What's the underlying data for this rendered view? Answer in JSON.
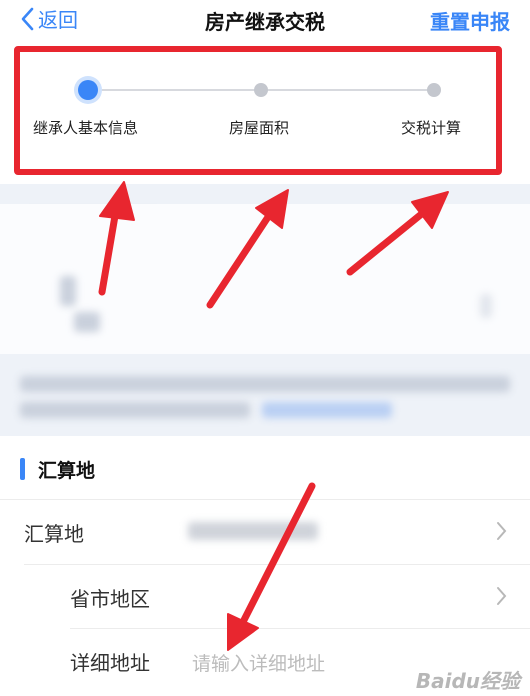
{
  "navbar": {
    "back_label": "返回",
    "title": "房产继承交税",
    "reset_label": "重置申报"
  },
  "steps": [
    {
      "label": "继承人基本信息",
      "state": "active"
    },
    {
      "label": "房屋面积",
      "state": "pending"
    },
    {
      "label": "交税计算",
      "state": "pending"
    }
  ],
  "section": {
    "title": "汇算地",
    "rows": [
      {
        "label": "汇算地"
      },
      {
        "label": "省市地区"
      },
      {
        "label": "详细地址",
        "placeholder": "请输入详细地址"
      }
    ]
  },
  "colors": {
    "accent": "#3a86f7",
    "highlight": "#e8262f"
  },
  "watermark": "Baidu经验"
}
